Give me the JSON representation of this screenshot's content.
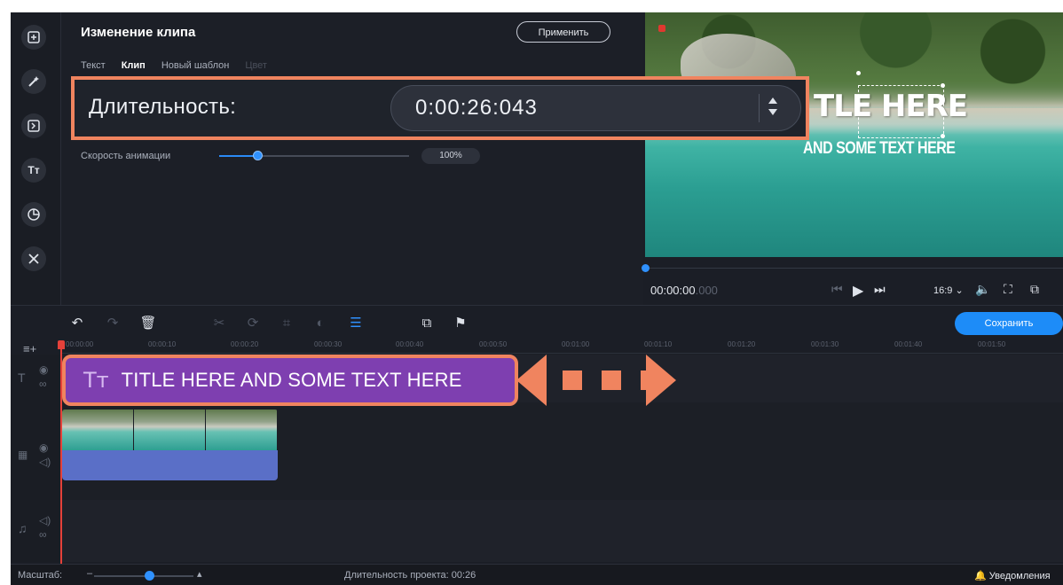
{
  "editor": {
    "title": "Изменение клипа",
    "apply_label": "Применить",
    "tabs": [
      {
        "label": "Текст",
        "state": "normal"
      },
      {
        "label": "Клип",
        "state": "active"
      },
      {
        "label": "Новый шаблон",
        "state": "normal"
      },
      {
        "label": "Цвет",
        "state": "disabled"
      }
    ],
    "duration_label": "Длительность:",
    "duration_value": "0:00:26:043",
    "speed_label": "Скорость анимации",
    "speed_value": "100%",
    "speed_fraction": 0.2
  },
  "sidebar": {
    "tools": [
      {
        "icon": "import-icon"
      },
      {
        "icon": "magic-wand-icon"
      },
      {
        "icon": "transitions-icon"
      },
      {
        "icon": "titles-icon",
        "glyph": "Tт"
      },
      {
        "icon": "stickers-icon"
      },
      {
        "icon": "more-tools-icon"
      }
    ]
  },
  "preview": {
    "title_text": "TLE HERE",
    "subtitle_text": "AND SOME TEXT HERE",
    "time_current": "00:00:00",
    "time_ms": ".000",
    "aspect": "16:9 ⌄",
    "progress_fraction": 0
  },
  "timeline": {
    "save_label": "Сохранить",
    "ruler_ticks": [
      "00:00:00",
      "00:00:10",
      "00:00:20",
      "00:00:30",
      "00:00:40",
      "00:00:50",
      "00:01:00",
      "00:01:10",
      "00:01:20",
      "00:01:30",
      "00:01:40",
      "00:01:50"
    ],
    "title_clip_label": "TITLE HERE AND SOME TEXT HERE",
    "title_clip_glyph": "Tт"
  },
  "status": {
    "zoom_label": "Масштаб:",
    "zoom_fraction": 0.55,
    "project_duration": "Длительность проекта: 00:26",
    "notifications": "Уведомления"
  },
  "colors": {
    "accent": "#1d8cf8",
    "highlight": "#f0845f",
    "title_clip": "#7e3fb0",
    "audio_clip": "#5a6fc7",
    "playhead": "#e5413a"
  }
}
